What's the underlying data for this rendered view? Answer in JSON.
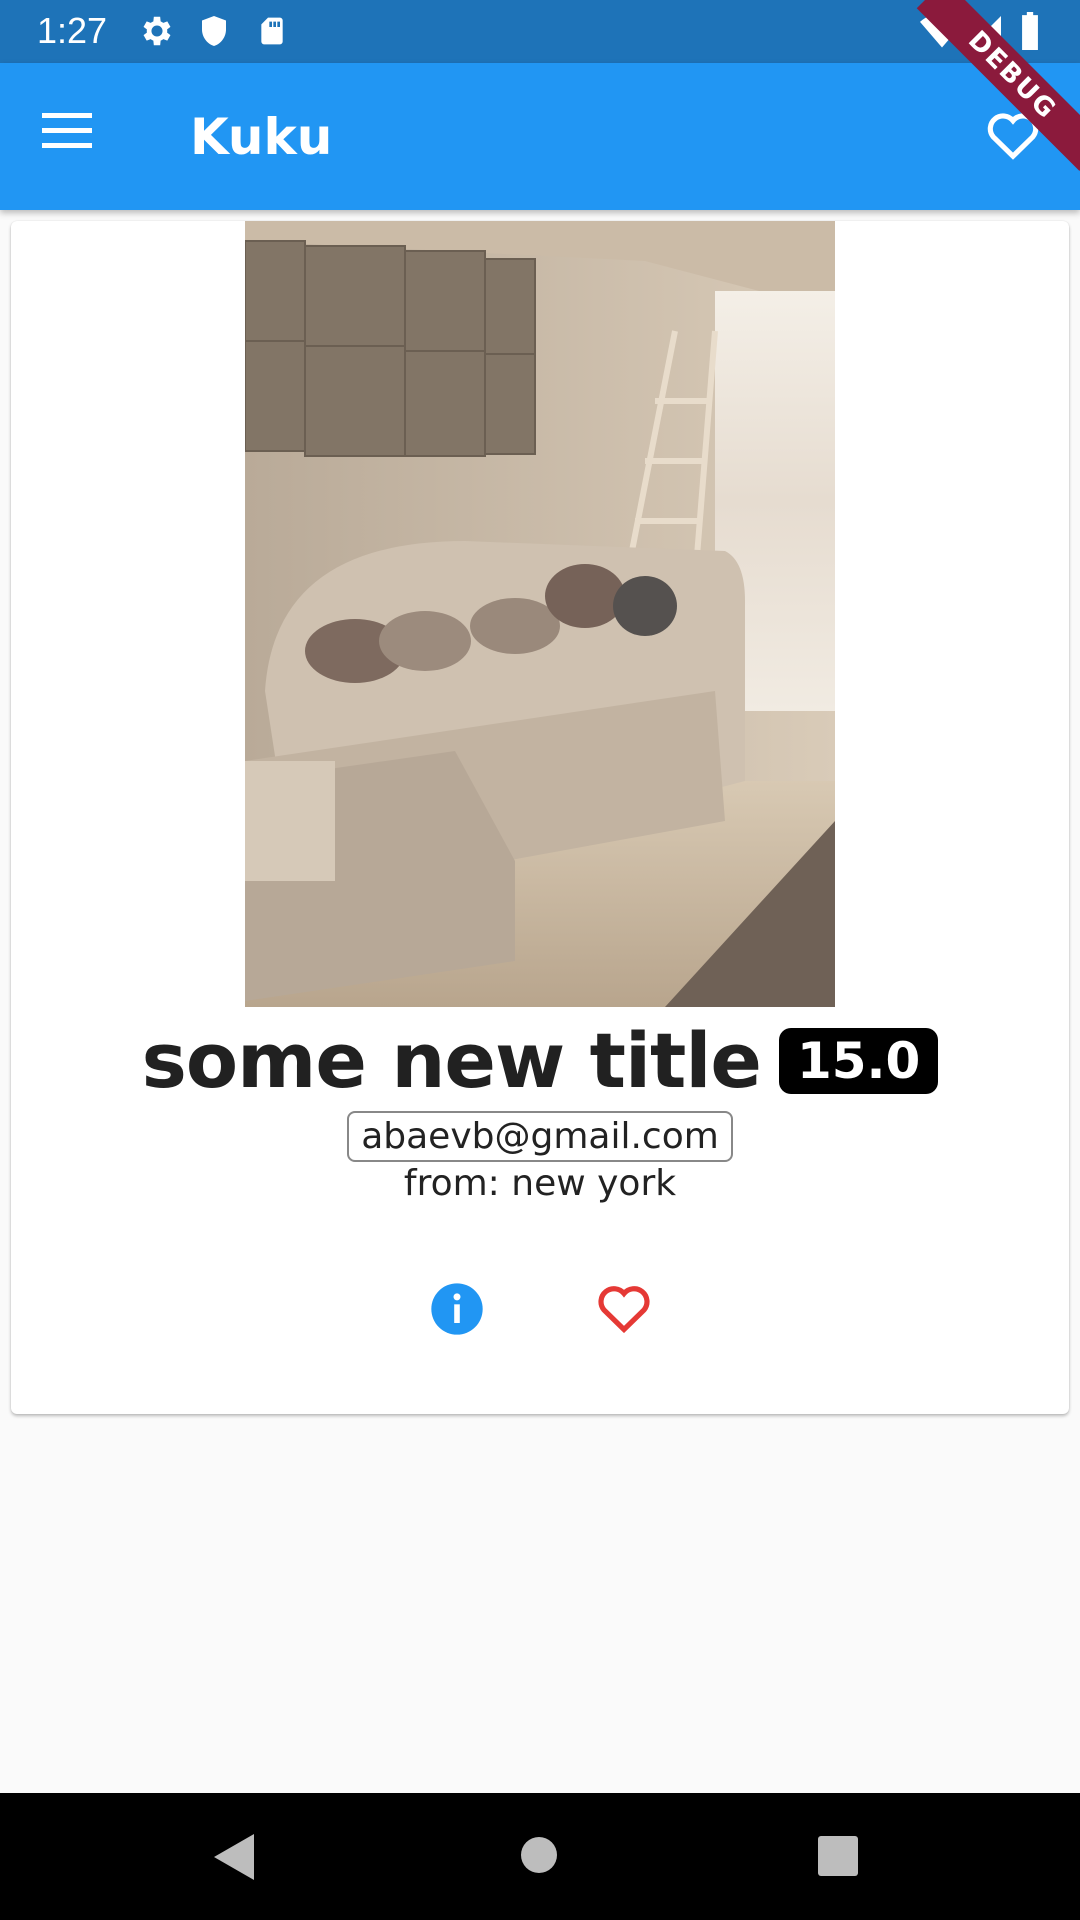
{
  "status_bar": {
    "time": "1:27",
    "icons": [
      "gear-icon",
      "shield-icon",
      "sd-card-icon",
      "wifi-icon",
      "signal-icon",
      "battery-icon"
    ]
  },
  "app_bar": {
    "title": "Kuku",
    "menu_icon": "hamburger-menu-icon",
    "action_icon": "heart-outline-icon",
    "color": "#2196f3"
  },
  "debug_banner": {
    "label": "DEBUG"
  },
  "card": {
    "title": "some new title",
    "price": "15.0",
    "email": "abaevb@gmail.com",
    "location": "from: new york",
    "actions": [
      "info-icon",
      "heart-outline-icon"
    ],
    "info_color": "#2196f3",
    "heart_color": "#e53935"
  },
  "nav_bar": {
    "buttons": [
      "back-icon",
      "home-icon",
      "recents-icon"
    ]
  }
}
